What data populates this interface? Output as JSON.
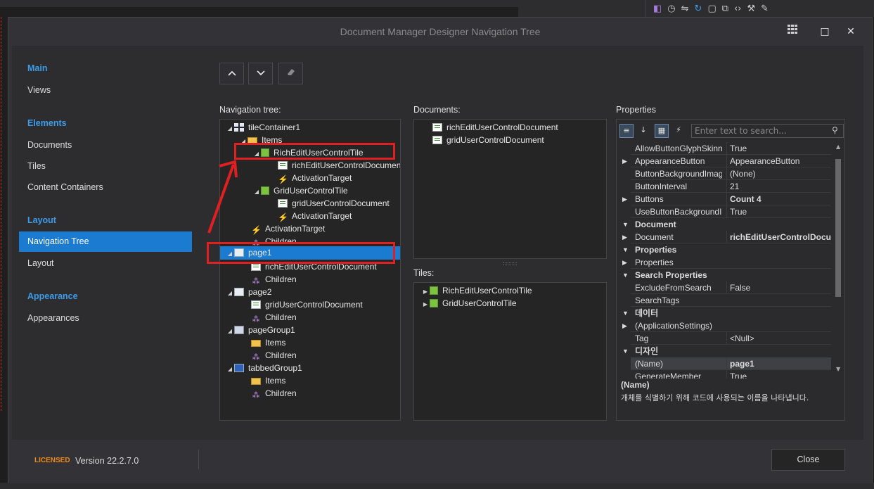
{
  "dialog": {
    "title": "Document Manager Designer Navigation Tree",
    "window_buttons": {
      "grid_icon": "grid-icon",
      "maximize": "□",
      "close": "✕"
    }
  },
  "sidebar": {
    "groups": [
      {
        "label": "Main",
        "items": [
          "Views"
        ]
      },
      {
        "label": "Elements",
        "items": [
          "Documents",
          "Tiles",
          "Content Containers"
        ]
      },
      {
        "label": "Layout",
        "items": [
          "Navigation Tree",
          "Layout"
        ]
      },
      {
        "label": "Appearance",
        "items": [
          "Appearances"
        ]
      }
    ],
    "selected": "Navigation Tree"
  },
  "toolbar": {
    "up": "^",
    "down": "v",
    "clear_icon": "eraser-icon"
  },
  "navigation_tree": {
    "label": "Navigation tree:",
    "nodes": [
      "tileContainer1",
      "Items",
      "RichEditUserControlTile",
      "richEditUserControlDocument",
      "ActivationTarget",
      "GridUserControlTile",
      "gridUserControlDocument",
      "ActivationTarget",
      "ActivationTarget",
      "Children",
      "page1",
      "richEditUserControlDocument",
      "Children",
      "page2",
      "gridUserControlDocument",
      "Children",
      "pageGroup1",
      "Items",
      "Children",
      "tabbedGroup1",
      "Items",
      "Children"
    ]
  },
  "documents": {
    "label": "Documents:",
    "items": [
      "richEditUserControlDocument",
      "gridUserControlDocument"
    ]
  },
  "tiles": {
    "label": "Tiles:",
    "items": [
      "RichEditUserControlTile",
      "GridUserControlTile"
    ]
  },
  "properties": {
    "label": "Properties",
    "search_placeholder": "Enter text to search...",
    "rows": [
      {
        "name": "AllowButtonGlyphSkinning",
        "value": "True"
      },
      {
        "name": "AppearanceButton",
        "value": "AppearanceButton"
      },
      {
        "name": "ButtonBackgroundImage",
        "value": "(None)"
      },
      {
        "name": "ButtonInterval",
        "value": "21"
      },
      {
        "name": "Buttons",
        "value": "Count 4"
      },
      {
        "name": "UseButtonBackgroundImages",
        "value": "True"
      },
      {
        "category": "Document"
      },
      {
        "name": "Document",
        "value": "richEditUserControlDocument"
      },
      {
        "category": "Properties"
      },
      {
        "name": "Properties",
        "value": ""
      },
      {
        "category": "Search Properties"
      },
      {
        "name": "ExcludeFromSearch",
        "value": "False"
      },
      {
        "name": "SearchTags",
        "value": ""
      },
      {
        "category": "데이터"
      },
      {
        "name": "(ApplicationSettings)",
        "value": ""
      },
      {
        "name": "Tag",
        "value": "<Null>"
      },
      {
        "category": "디자인"
      },
      {
        "name": "(Name)",
        "value": "page1"
      },
      {
        "name": "GenerateMember",
        "value": "True"
      }
    ],
    "description_title": "(Name)",
    "description_text": "개체를 식별하기 위해 코드에 사용되는 이름을 나타냅니다."
  },
  "footer": {
    "licensed": "LICENSED",
    "version": "Version 22.2.7.0",
    "close": "Close"
  },
  "colors": {
    "accent": "#1a7bd0",
    "group_label": "#3c9ce8",
    "highlight": "#e02020",
    "licensed": "#f08a1a"
  }
}
